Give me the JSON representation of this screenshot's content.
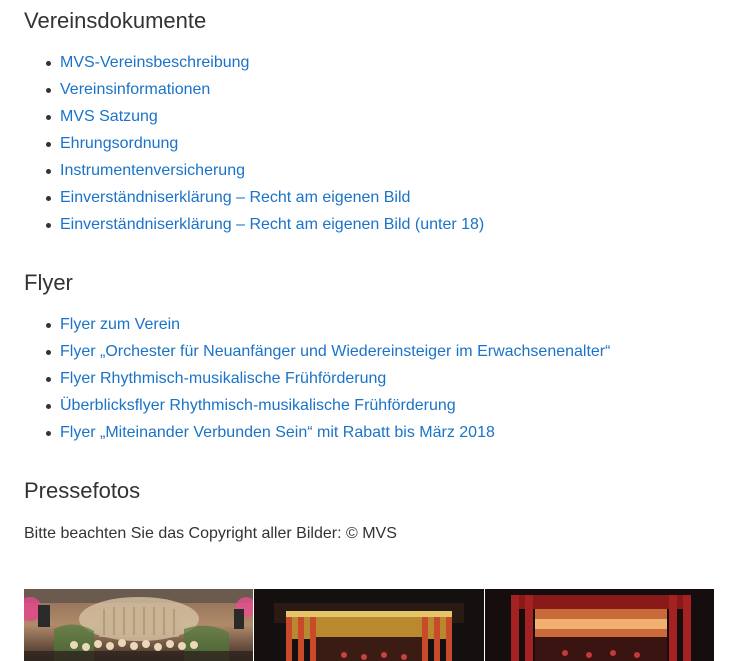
{
  "sections": {
    "vereinsdokumente": {
      "heading": "Vereinsdokumente",
      "links": [
        "MVS-Vereinsbeschreibung",
        "Vereinsinformationen",
        "MVS Satzung",
        "Ehrungsordnung",
        "Instrumentenversicherung",
        "Einverständniserklärung – Recht am eigenen Bild",
        "Einverständniserklärung – Recht am eigenen Bild (unter 18)"
      ]
    },
    "flyer": {
      "heading": "Flyer",
      "links": [
        "Flyer zum Verein",
        "Flyer „Orchester für Neuanfänger und Wiedereinsteiger im Erwachsenenalter“",
        "Flyer Rhythmisch-musikalische Frühförderung",
        "Überblicksflyer Rhythmisch-musikalische Frühförderung",
        "Flyer „Miteinander Verbunden Sein“ mit Rabatt bis März 2018"
      ]
    },
    "pressefotos": {
      "heading": "Pressefotos",
      "note": "Bitte beachten Sie das Copyright aller Bilder: © MVS"
    }
  },
  "colors": {
    "link": "#1a73c8",
    "text": "#333333"
  }
}
